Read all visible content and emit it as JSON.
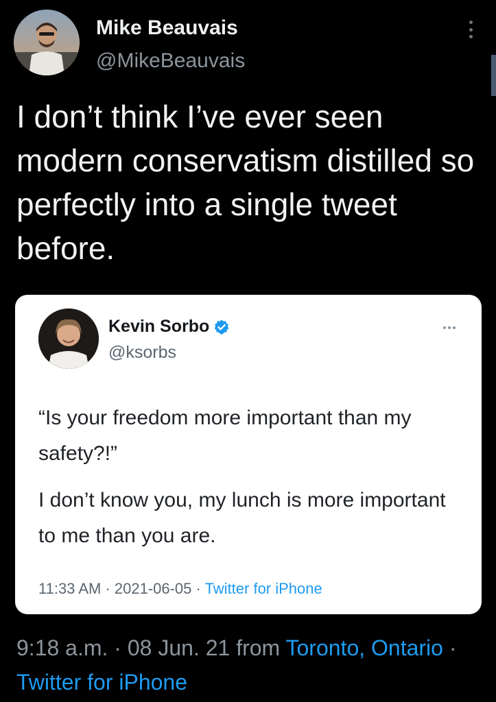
{
  "tweet": {
    "author_name": "Mike Beauvais",
    "author_handle": "@MikeBeauvais",
    "text": "I don’t think I’ve ever seen modern conservatism distilled so perfectly into a single tweet before.",
    "time": "9:18 a.m. · 08 Jun. 21 from ",
    "location": "Toronto, Ontario",
    "separator": " · ",
    "source": "Twitter for iPhone"
  },
  "quoted": {
    "author_name": "Kevin Sorbo",
    "author_handle": "@ksorbs",
    "paragraph_1": "“Is your freedom more important than my safety?!”",
    "paragraph_2": "I don’t know you, my lunch is more important to me than you are.",
    "timestamp": "11:33 AM · 2021-06-05 · ",
    "source": "Twitter for iPhone"
  },
  "colors": {
    "background": "#000000",
    "link": "#1d9bf0",
    "verified": "#1d9bf0"
  },
  "icons": [
    "more-vertical-icon",
    "verified-badge-icon",
    "more-horizontal-icon"
  ]
}
